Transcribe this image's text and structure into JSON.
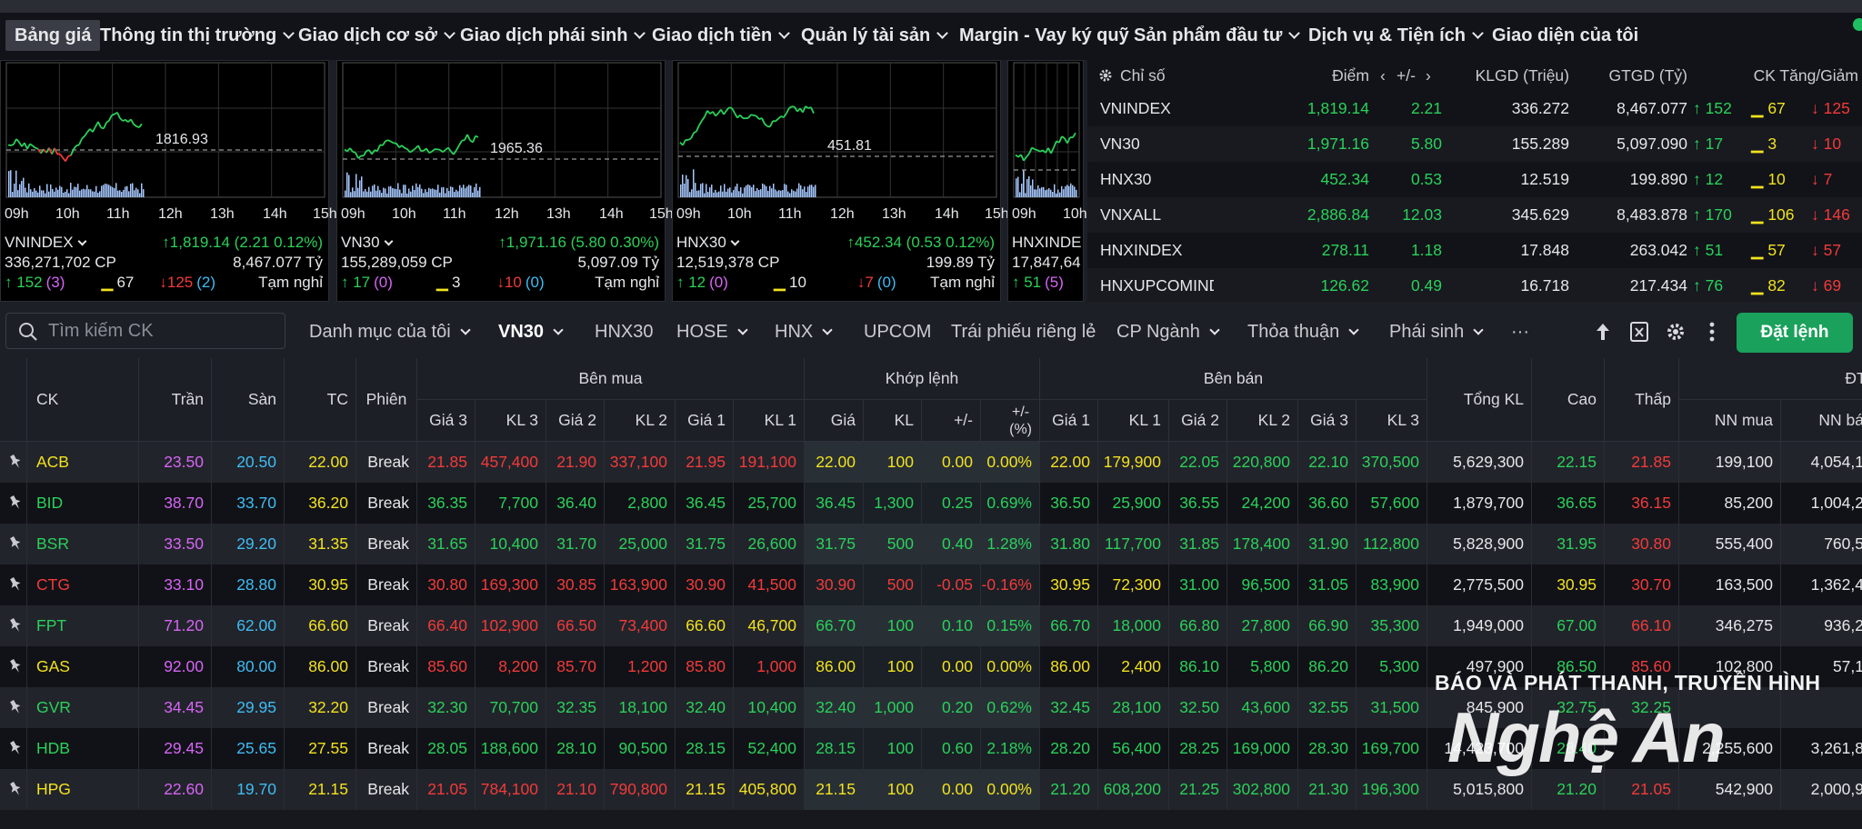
{
  "nav": {
    "items": [
      {
        "label": "Bảng giá",
        "active": true,
        "chevron": false
      },
      {
        "label": "Thông tin thị trường",
        "chevron": true
      },
      {
        "label": "Giao dịch cơ sở",
        "chevron": true
      },
      {
        "label": "Giao dịch phái sinh",
        "chevron": true
      },
      {
        "label": "Giao dịch tiền",
        "chevron": true
      },
      {
        "label": "Quản lý tài sản",
        "chevron": true
      },
      {
        "label": "Margin - Vay ký quỹ",
        "chevron": false
      },
      {
        "label": "Sản phẩm đầu tư",
        "chevron": true
      },
      {
        "label": "Dịch vụ & Tiện ích",
        "chevron": true
      },
      {
        "label": "Giao diện của tôi",
        "chevron": false
      }
    ]
  },
  "charts": [
    {
      "name": "VNINDEX",
      "ref_label": "1816.93",
      "hours": [
        "09h",
        "10h",
        "11h",
        "12h",
        "13h",
        "14h",
        "15h"
      ],
      "value": "↑1,819.14 (2.21 0.12%)",
      "volume": "336,271,702 CP",
      "value_ty": "8,467.077 Tỷ",
      "up": "↑ 152",
      "up_ceil": "(3)",
      "ref_count": "67",
      "down": "↓125",
      "down_floor": "(2)",
      "status": "Tạm nghỉ"
    },
    {
      "name": "VN30",
      "ref_label": "1965.36",
      "hours": [
        "09h",
        "10h",
        "11h",
        "12h",
        "13h",
        "14h",
        "15h"
      ],
      "value": "↑1,971.16 (5.80 0.30%)",
      "volume": "155,289,059 CP",
      "value_ty": "5,097.09 Tỷ",
      "up": "↑ 17",
      "up_ceil": "(0)",
      "ref_count": "3",
      "down": "↓10",
      "down_floor": "(0)",
      "status": "Tạm nghỉ"
    },
    {
      "name": "HNX30",
      "ref_label": "451.81",
      "hours": [
        "09h",
        "10h",
        "11h",
        "12h",
        "13h",
        "14h",
        "15h"
      ],
      "value": "↑452.34 (0.53 0.12%)",
      "volume": "12,519,378 CP",
      "value_ty": "199.89 Tỷ",
      "up": "↑ 12",
      "up_ceil": "(0)",
      "ref_count": "10",
      "down": "↓7",
      "down_floor": "(0)",
      "status": "Tạm nghỉ"
    },
    {
      "name": "HNXINDE",
      "ref_label": "",
      "hours": [
        "09h",
        "10h"
      ],
      "value": "",
      "volume": "17,847,64",
      "value_ty": "",
      "up": "↑ 51",
      "up_ceil": "(5)",
      "ref_count": "",
      "down": "",
      "down_floor": "",
      "status": ""
    }
  ],
  "index_table": {
    "headers": {
      "name": "Chỉ số",
      "point": "Điểm",
      "change": "+/-",
      "volume": "KLGD (Triệu)",
      "value": "GTGD (Tỷ)",
      "breadth": "CK Tăng/Giảm"
    },
    "rows": [
      {
        "name": "VNINDEX",
        "point": "1,819.14",
        "change": "2.21",
        "volume": "336.272",
        "value": "8,467.077",
        "up": "152",
        "ref": "67",
        "down": "125"
      },
      {
        "name": "VN30",
        "point": "1,971.16",
        "change": "5.80",
        "volume": "155.289",
        "value": "5,097.090",
        "up": "17",
        "ref": "3",
        "down": "10"
      },
      {
        "name": "HNX30",
        "point": "452.34",
        "change": "0.53",
        "volume": "12.519",
        "value": "199.890",
        "up": "12",
        "ref": "10",
        "down": "7"
      },
      {
        "name": "VNXALL",
        "point": "2,886.84",
        "change": "12.03",
        "volume": "345.629",
        "value": "8,483.878",
        "up": "170",
        "ref": "106",
        "down": "146"
      },
      {
        "name": "HNXINDEX",
        "point": "278.11",
        "change": "1.18",
        "volume": "17.848",
        "value": "263.042",
        "up": "51",
        "ref": "57",
        "down": "57"
      },
      {
        "name": "HNXUPCOMINDE",
        "point": "126.62",
        "change": "0.49",
        "volume": "16.718",
        "value": "217.434",
        "up": "76",
        "ref": "82",
        "down": "69"
      }
    ]
  },
  "toolbar": {
    "search_placeholder": "Tìm kiếm CK",
    "tabs": [
      {
        "label": "Danh mục của tôi",
        "chevron": true
      },
      {
        "label": "VN30",
        "chevron": true,
        "active": true
      },
      {
        "label": "HNX30",
        "chevron": false
      },
      {
        "label": "HOSE",
        "chevron": true
      },
      {
        "label": "HNX",
        "chevron": true
      },
      {
        "label": "UPCOM",
        "chevron": false
      },
      {
        "label": "Trái phiếu riêng lẻ",
        "chevron": false
      },
      {
        "label": "CP Ngành",
        "chevron": true
      },
      {
        "label": "Thỏa thuận",
        "chevron": true
      },
      {
        "label": "Phái sinh",
        "chevron": true
      },
      {
        "label": "···",
        "chevron": false
      }
    ],
    "order_label": "Đặt lệnh"
  },
  "board": {
    "headers": {
      "ck": "CK",
      "ceiling": "Trần",
      "floor": "Sàn",
      "ref": "TC",
      "session": "Phiên",
      "bid_group": "Bên mua",
      "match_group": "Khớp lệnh",
      "ask_group": "Bên bán",
      "total": "Tổng KL",
      "high": "Cao",
      "low": "Thấp",
      "foreign_group": "ĐTNN",
      "bid_sub": [
        "Giá 3",
        "KL 3",
        "Giá 2",
        "KL 2",
        "Giá 1",
        "KL 1"
      ],
      "match_sub": [
        "Giá",
        "KL",
        "+/-",
        "+/-\n(%)"
      ],
      "ask_sub": [
        "Giá 1",
        "KL 1",
        "Giá 2",
        "KL 2",
        "Giá 3",
        "KL 3"
      ],
      "foreign_sub": [
        "NN mua",
        "NN bá"
      ]
    },
    "rows": [
      {
        "ck": "ACB",
        "ceil": "23.50",
        "floor": "20.50",
        "ref": "22.00",
        "sess": "Break",
        "b3": "21.85",
        "bk3": "457,400",
        "b2": "21.90",
        "bk2": "337,100",
        "b1": "21.95",
        "bk1": "191,100",
        "mp": "22.00",
        "mk": "100",
        "mc": "0.00",
        "mpct": "0.00%",
        "a1": "22.00",
        "ak1": "179,900",
        "a2": "22.05",
        "ak2": "220,800",
        "a3": "22.10",
        "ak3": "370,500",
        "tot": "5,629,300",
        "hi": "22.15",
        "lo": "21.85",
        "nnb": "199,100",
        "nns": "4,054,1"
      },
      {
        "ck": "BID",
        "ceil": "38.70",
        "floor": "33.70",
        "ref": "36.20",
        "sess": "Break",
        "b3": "36.35",
        "bk3": "7,700",
        "b2": "36.40",
        "bk2": "2,800",
        "b1": "36.45",
        "bk1": "25,700",
        "mp": "36.45",
        "mk": "1,300",
        "mc": "0.25",
        "mpct": "0.69%",
        "a1": "36.50",
        "ak1": "25,900",
        "a2": "36.55",
        "ak2": "24,200",
        "a3": "36.60",
        "ak3": "57,600",
        "tot": "1,879,700",
        "hi": "36.65",
        "lo": "36.15",
        "nnb": "85,200",
        "nns": "1,004,2"
      },
      {
        "ck": "BSR",
        "ceil": "33.50",
        "floor": "29.20",
        "ref": "31.35",
        "sess": "Break",
        "b3": "31.65",
        "bk3": "10,400",
        "b2": "31.70",
        "bk2": "25,000",
        "b1": "31.75",
        "bk1": "26,600",
        "mp": "31.75",
        "mk": "500",
        "mc": "0.40",
        "mpct": "1.28%",
        "a1": "31.80",
        "ak1": "117,700",
        "a2": "31.85",
        "ak2": "178,400",
        "a3": "31.90",
        "ak3": "112,800",
        "tot": "5,828,900",
        "hi": "31.95",
        "lo": "30.80",
        "nnb": "555,400",
        "nns": "760,5"
      },
      {
        "ck": "CTG",
        "ceil": "33.10",
        "floor": "28.80",
        "ref": "30.95",
        "sess": "Break",
        "b3": "30.80",
        "bk3": "169,300",
        "b2": "30.85",
        "bk2": "163,900",
        "b1": "30.90",
        "bk1": "41,500",
        "mp": "30.90",
        "mk": "500",
        "mc": "-0.05",
        "mpct": "-0.16%",
        "a1": "30.95",
        "ak1": "72,300",
        "a2": "31.00",
        "ak2": "96,500",
        "a3": "31.05",
        "ak3": "83,900",
        "tot": "2,775,500",
        "hi": "30.95",
        "lo": "30.70",
        "nnb": "163,500",
        "nns": "1,362,4"
      },
      {
        "ck": "FPT",
        "ceil": "71.20",
        "floor": "62.00",
        "ref": "66.60",
        "sess": "Break",
        "b3": "66.40",
        "bk3": "102,900",
        "b2": "66.50",
        "bk2": "73,400",
        "b1": "66.60",
        "bk1": "46,700",
        "mp": "66.70",
        "mk": "100",
        "mc": "0.10",
        "mpct": "0.15%",
        "a1": "66.70",
        "ak1": "18,000",
        "a2": "66.80",
        "ak2": "27,800",
        "a3": "66.90",
        "ak3": "35,300",
        "tot": "1,949,000",
        "hi": "67.00",
        "lo": "66.10",
        "nnb": "346,275",
        "nns": "936,2"
      },
      {
        "ck": "GAS",
        "ceil": "92.00",
        "floor": "80.00",
        "ref": "86.00",
        "sess": "Break",
        "b3": "85.60",
        "bk3": "8,200",
        "b2": "85.70",
        "bk2": "1,200",
        "b1": "85.80",
        "bk1": "1,000",
        "mp": "86.00",
        "mk": "100",
        "mc": "0.00",
        "mpct": "0.00%",
        "a1": "86.00",
        "ak1": "2,400",
        "a2": "86.10",
        "ak2": "5,800",
        "a3": "86.20",
        "ak3": "5,300",
        "tot": "497,900",
        "hi": "86.50",
        "lo": "85.60",
        "nnb": "102,800",
        "nns": "57,1"
      },
      {
        "ck": "GVR",
        "ceil": "34.45",
        "floor": "29.95",
        "ref": "32.20",
        "sess": "Break",
        "b3": "32.30",
        "bk3": "70,700",
        "b2": "32.35",
        "bk2": "18,100",
        "b1": "32.40",
        "bk1": "10,400",
        "mp": "32.40",
        "mk": "1,000",
        "mc": "0.20",
        "mpct": "0.62%",
        "a1": "32.45",
        "ak1": "28,100",
        "a2": "32.50",
        "ak2": "43,600",
        "a3": "32.55",
        "ak3": "31,500",
        "tot": "845,900",
        "hi": "32.75",
        "lo": "32.25",
        "nnb": "",
        "nns": ""
      },
      {
        "ck": "HDB",
        "ceil": "29.45",
        "floor": "25.65",
        "ref": "27.55",
        "sess": "Break",
        "b3": "28.05",
        "bk3": "188,600",
        "b2": "28.10",
        "bk2": "90,500",
        "b1": "28.15",
        "bk1": "52,400",
        "mp": "28.15",
        "mk": "100",
        "mc": "0.60",
        "mpct": "2.18%",
        "a1": "28.20",
        "ak1": "56,400",
        "a2": "28.25",
        "ak2": "169,000",
        "a3": "28.30",
        "ak3": "169,700",
        "tot": "14,423,700",
        "hi": "28.40",
        "lo": "",
        "nnb": "2,255,600",
        "nns": "3,261,8"
      },
      {
        "ck": "HPG",
        "ceil": "22.60",
        "floor": "19.70",
        "ref": "21.15",
        "sess": "Break",
        "b3": "21.05",
        "bk3": "784,100",
        "b2": "21.10",
        "bk2": "790,800",
        "b1": "21.15",
        "bk1": "405,800",
        "mp": "21.15",
        "mk": "100",
        "mc": "0.00",
        "mpct": "0.00%",
        "a1": "21.20",
        "ak1": "608,200",
        "a2": "21.25",
        "ak2": "302,800",
        "a3": "21.30",
        "ak3": "196,300",
        "tot": "5,015,800",
        "hi": "21.20",
        "lo": "21.05",
        "nnb": "542,900",
        "nns": "2,000,9"
      }
    ]
  },
  "watermark": {
    "line1": "BÁO VÀ PHÁT THANH, TRUYỀN HÌNH",
    "line2": "Nghệ An"
  },
  "colors": {
    "up": "#2ad15a",
    "down": "#f23a3a",
    "ref": "#f2e21e",
    "ceiling": "#d665f5",
    "floor": "#3dbdf5",
    "accent": "#1aa15c"
  }
}
